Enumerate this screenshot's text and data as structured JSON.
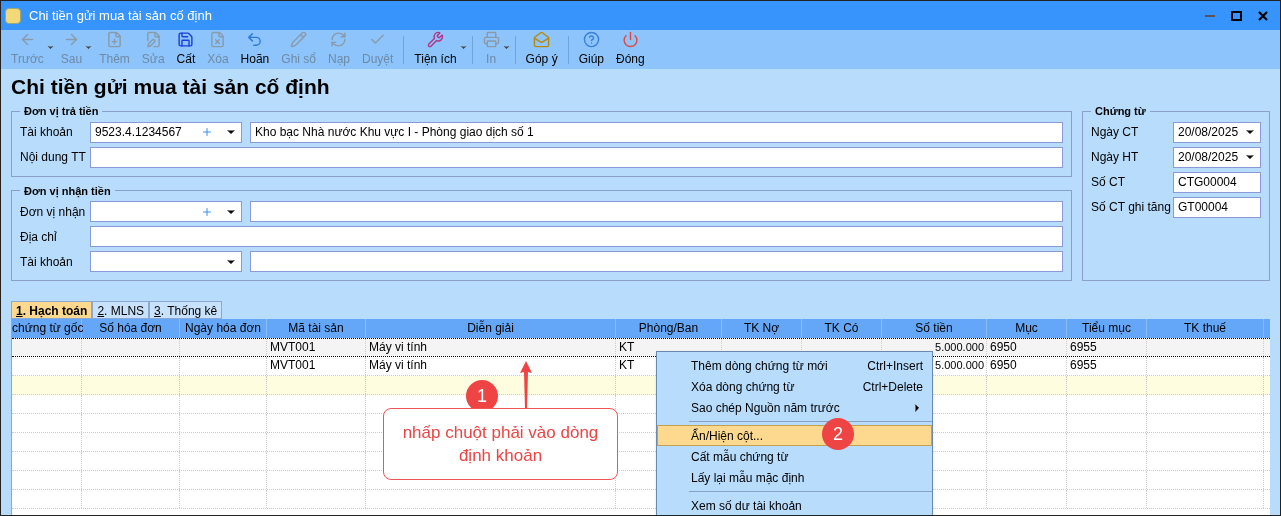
{
  "window": {
    "title": "Chi tiền gửi mua tài sản cố định"
  },
  "toolbar": [
    {
      "label": "Trước",
      "disabled": true,
      "dropdown": true,
      "separator_before": false
    },
    {
      "label": "Sau",
      "disabled": true,
      "dropdown": true,
      "separator_before": false
    },
    {
      "label": "Thêm",
      "disabled": true,
      "dropdown": false,
      "separator_before": false
    },
    {
      "label": "Sửa",
      "disabled": true,
      "dropdown": false,
      "separator_before": false
    },
    {
      "label": "Cất",
      "disabled": false,
      "dropdown": false,
      "separator_before": false
    },
    {
      "label": "Xóa",
      "disabled": true,
      "dropdown": false,
      "separator_before": false
    },
    {
      "label": "Hoãn",
      "disabled": false,
      "dropdown": false,
      "separator_before": false
    },
    {
      "label": "Ghi sổ",
      "disabled": true,
      "dropdown": false,
      "separator_before": false
    },
    {
      "label": "Nạp",
      "disabled": true,
      "dropdown": false,
      "separator_before": false
    },
    {
      "label": "Duyệt",
      "disabled": true,
      "dropdown": false,
      "separator_before": false
    },
    {
      "label": "Tiện ích",
      "disabled": false,
      "dropdown": true,
      "separator_before": true
    },
    {
      "label": "In",
      "disabled": true,
      "dropdown": true,
      "separator_before": true
    },
    {
      "label": "Góp ý",
      "disabled": false,
      "dropdown": false,
      "separator_before": true
    },
    {
      "label": "Giúp",
      "disabled": false,
      "dropdown": false,
      "separator_before": true
    },
    {
      "label": "Đóng",
      "disabled": false,
      "dropdown": false,
      "separator_before": false
    }
  ],
  "heading": "Chi tiền gửi mua tài sản cố định",
  "payer": {
    "title": "Đơn vị trả tiền",
    "account_label": "Tài khoản",
    "account_value": "9523.4.1234567",
    "account_name": "Kho bạc Nhà nước Khu vực I - Phòng giao dịch số 1",
    "content_label": "Nội dung TT"
  },
  "payee": {
    "title": "Đơn vị nhận tiền",
    "unit_label": "Đơn vị nhận",
    "address_label": "Địa chỉ",
    "account_label": "Tài khoản"
  },
  "voucher": {
    "title": "Chứng từ",
    "fields": [
      {
        "kind": "date",
        "label": "Ngày CT",
        "value": "20/08/2025"
      },
      {
        "kind": "date",
        "label": "Ngày HT",
        "value": "20/08/2025"
      },
      {
        "kind": "text",
        "label": "Số CT",
        "value": "CTG00004"
      },
      {
        "kind": "text",
        "label": "Số CT ghi tăng",
        "value": "GT00004"
      }
    ]
  },
  "tabs": [
    {
      "key": "1",
      "label": ". Hạch toán",
      "selected": true
    },
    {
      "key": "2",
      "label": ". MLNS",
      "selected": false
    },
    {
      "key": "3",
      "label": ". Thống kê",
      "selected": false
    }
  ],
  "grid": {
    "columns": [
      "chứng từ gốc",
      "Số hóa đơn",
      "Ngày hóa đơn",
      "Mã tài sản",
      "Diễn giải",
      "Phòng/Ban",
      "TK Nợ",
      "TK Có",
      "Số tiền",
      "Mục",
      "Tiểu mục",
      "TK thuế"
    ],
    "rows": [
      {
        "selected": true,
        "cells": [
          "",
          "",
          "",
          "MVT001",
          "Máy vi tính",
          "KT",
          "",
          "",
          "5.000.000",
          "6950",
          "6955",
          ""
        ]
      },
      {
        "selected": false,
        "cells": [
          "",
          "",
          "",
          "MVT001",
          "Máy vi tính",
          "KT",
          "",
          "",
          "5.000.000",
          "6950",
          "6955",
          ""
        ]
      }
    ],
    "new_row_highlighted": true
  },
  "context_menu": [
    {
      "label": "Thêm dòng chứng từ mới",
      "shortcut": "Ctrl+Insert",
      "submenu": false,
      "separator_before": false,
      "selected": false
    },
    {
      "label": "Xóa dòng chứng từ",
      "shortcut": "Ctrl+Delete",
      "submenu": false,
      "separator_before": false,
      "selected": false
    },
    {
      "label": "Sao chép Nguồn năm trước",
      "submenu": true,
      "separator_before": false,
      "selected": false
    },
    {
      "label": "Ẩn/Hiện cột...",
      "submenu": false,
      "separator_before": true,
      "selected": true
    },
    {
      "label": "Cất mẫu chứng từ",
      "submenu": false,
      "separator_before": false,
      "selected": false
    },
    {
      "label": "Lấy lại mẫu mặc định",
      "submenu": false,
      "separator_before": false,
      "selected": false
    },
    {
      "label": "Xem số dư tài khoản",
      "submenu": false,
      "separator_before": true,
      "selected": false
    }
  ],
  "annotations": {
    "step_1": "1",
    "step_2": "2",
    "callout": "nhấp chuột phải vào dòng định khoản"
  }
}
